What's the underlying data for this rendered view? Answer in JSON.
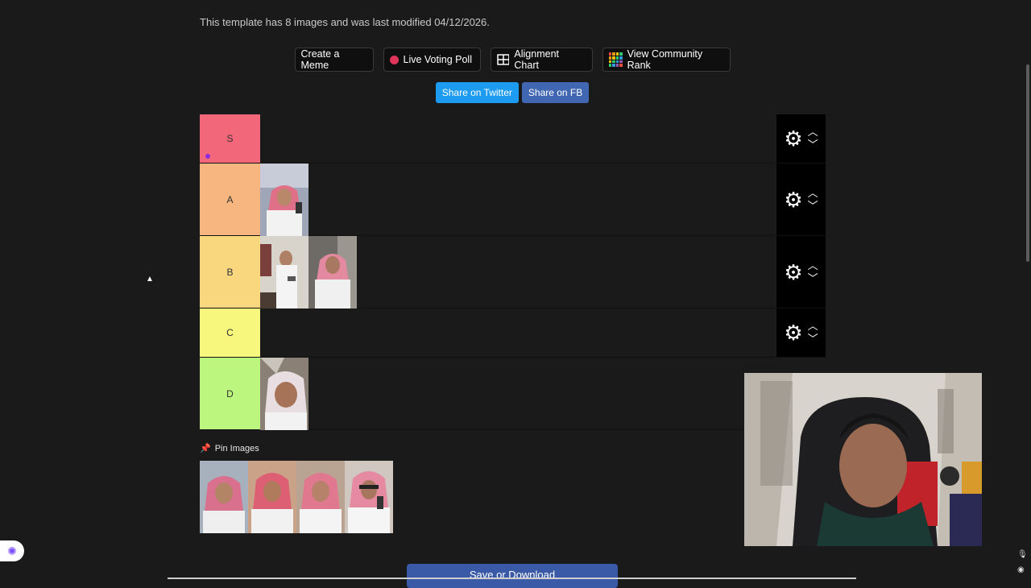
{
  "info": "This template has 8 images and was last modified 04/12/2026.",
  "buttons": {
    "create_meme": "Create a Meme",
    "live_poll": "Live Voting Poll",
    "alignment": "Alignment Chart",
    "community": "View Community Rank"
  },
  "share": {
    "twitter": "Share on Twitter",
    "fb": "Share on FB"
  },
  "tiers": [
    {
      "label": "S",
      "color": "#f2687a",
      "images": 0
    },
    {
      "label": "A",
      "color": "#f7b57f",
      "images": 1
    },
    {
      "label": "B",
      "color": "#f9d77f",
      "images": 2
    },
    {
      "label": "C",
      "color": "#f7f67d",
      "images": 0
    },
    {
      "label": "D",
      "color": "#bdf67e",
      "images": 1
    }
  ],
  "pin": {
    "label": "Pin Images",
    "images": 4
  },
  "save": "Save or Download",
  "icons": {
    "settings": "gear-icon",
    "move_up": "chevron-up-icon",
    "move_down": "chevron-down-icon",
    "pin": "pin-icon",
    "live": "red-dot-icon",
    "alignment": "grid-icon",
    "community": "mosaic-icon",
    "assistant": "brain-icon",
    "mic": "mic-icon",
    "camera": "camera-icon"
  }
}
